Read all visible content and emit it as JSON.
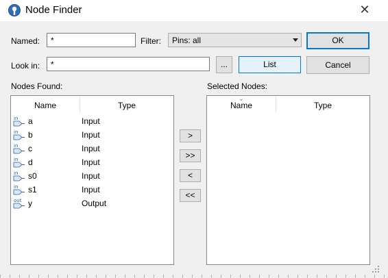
{
  "window": {
    "title": "Node Finder",
    "close_glyph": "✕"
  },
  "named": {
    "label": "Named:",
    "value": "*"
  },
  "filter": {
    "label": "Filter:",
    "value": "Pins: all"
  },
  "look_in": {
    "label": "Look in:",
    "value": "*",
    "browse_label": "..."
  },
  "buttons": {
    "ok": "OK",
    "list": "List",
    "cancel": "Cancel"
  },
  "nodes_found": {
    "label": "Nodes Found:",
    "columns": [
      "Name",
      "Type"
    ],
    "rows": [
      {
        "icon": "in",
        "name": "a",
        "type": "Input"
      },
      {
        "icon": "in",
        "name": "b",
        "type": "Input"
      },
      {
        "icon": "in",
        "name": "c",
        "type": "Input"
      },
      {
        "icon": "in",
        "name": "d",
        "type": "Input"
      },
      {
        "icon": "in",
        "name": "s0",
        "type": "Input"
      },
      {
        "icon": "in",
        "name": "s1",
        "type": "Input"
      },
      {
        "icon": "out",
        "name": "y",
        "type": "Output"
      }
    ]
  },
  "selected_nodes": {
    "label": "Selected Nodes:",
    "columns": [
      "Name",
      "Type"
    ],
    "sort_glyph": "⌄"
  },
  "transfer": {
    "add": ">",
    "add_all": ">>",
    "remove": "<",
    "remove_all": "<<"
  },
  "colors": {
    "accent": "#0078d7",
    "window_bg": "#f0f0f0",
    "pin_blue": "#1f5fa8"
  }
}
